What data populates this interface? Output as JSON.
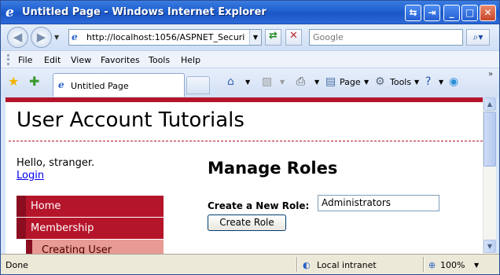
{
  "window": {
    "title": "Untitled Page - Windows Internet Explorer",
    "minimize_glyph": "_",
    "maximize_glyph": "□",
    "close_glyph": "✕"
  },
  "address_bar": {
    "url": "http://localhost:1056/ASPNET_Security_Tu",
    "search_placeholder": "Google"
  },
  "menu": {
    "items": [
      "File",
      "Edit",
      "View",
      "Favorites",
      "Tools",
      "Help"
    ]
  },
  "tabs": [
    {
      "label": "Untitled Page"
    }
  ],
  "command_bar": {
    "page_label": "Page",
    "tools_label": "Tools"
  },
  "page": {
    "site_title": "User Account Tutorials",
    "greeting": "Hello, stranger.",
    "login_link": "Login",
    "nav": {
      "home": "Home",
      "membership": "Membership",
      "creating_user": "Creating User"
    },
    "heading": "Manage Roles",
    "role_label": "Create a New Role:",
    "role_value": "Administrators",
    "create_button": "Create Role",
    "accent_color": "#b5152b"
  },
  "status_bar": {
    "status": "Done",
    "zone": "Local intranet",
    "zoom": "100%"
  }
}
